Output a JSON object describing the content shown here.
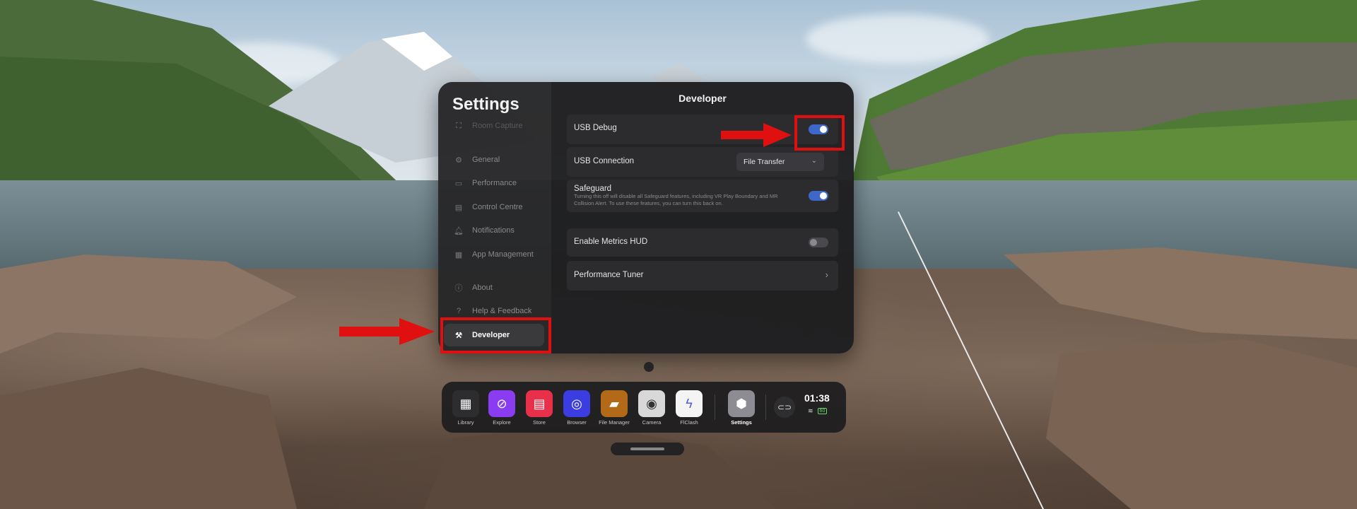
{
  "settings": {
    "title": "Settings",
    "nav": [
      {
        "label": "Room Capture",
        "icon": "room-capture-icon"
      },
      {
        "label": "General",
        "icon": "gear-icon"
      },
      {
        "label": "Performance",
        "icon": "performance-icon"
      },
      {
        "label": "Control Centre",
        "icon": "control-centre-icon"
      },
      {
        "label": "Notifications",
        "icon": "bell-icon"
      },
      {
        "label": "App Management",
        "icon": "apps-grid-icon"
      },
      {
        "label": "About",
        "icon": "info-icon"
      },
      {
        "label": "Help & Feedback",
        "icon": "help-icon"
      },
      {
        "label": "Developer",
        "icon": "tools-icon"
      }
    ],
    "active_nav": "Developer"
  },
  "developer": {
    "title": "Developer",
    "usb_debug": {
      "label": "USB Debug",
      "on": true
    },
    "usb_connection": {
      "label": "USB Connection",
      "value": "File Transfer"
    },
    "safeguard": {
      "label": "Safeguard",
      "description": "Turning this off will disable all Safeguard features, including VR Play Boundary and MR Collision Alert. To use these features, you can turn this back on.",
      "on": true
    },
    "metrics_hud": {
      "label": "Enable Metrics HUD",
      "on": false
    },
    "performance_tuner": {
      "label": "Performance Tuner"
    }
  },
  "dock": {
    "apps": [
      {
        "label": "Library",
        "icon": "library-icon",
        "color": "#2d2d30"
      },
      {
        "label": "Explore",
        "icon": "explore-icon",
        "color": "#8a3cf0"
      },
      {
        "label": "Store",
        "icon": "store-icon",
        "color": "#e8304a"
      },
      {
        "label": "Browser",
        "icon": "browser-icon",
        "color": "#3b3de0"
      },
      {
        "label": "File Manager",
        "icon": "folder-icon",
        "color": "#b36a18"
      },
      {
        "label": "Camera",
        "icon": "camera-icon",
        "color": "#d8d8d8"
      },
      {
        "label": "FlClash",
        "icon": "flclash-icon",
        "color": "#f4f4f4"
      },
      {
        "label": "Settings",
        "icon": "settings-icon",
        "color": "#8c8c92"
      }
    ],
    "time": "01:38",
    "battery": "60"
  },
  "annotation_color": "#e01010"
}
